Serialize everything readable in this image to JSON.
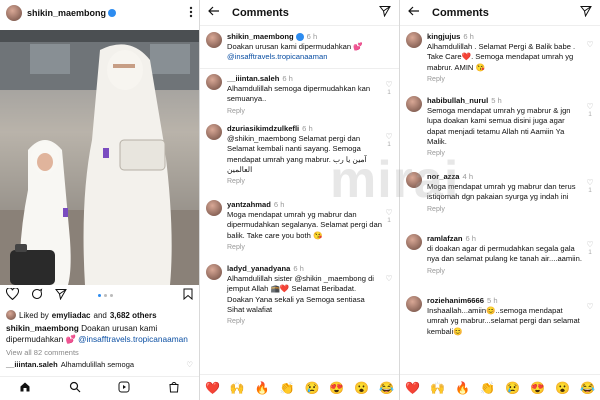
{
  "post": {
    "username": "shikin_maembong",
    "liked_by_prefix": "Liked by",
    "liked_by_user": "emyliadac",
    "liked_by_and": "and",
    "liked_by_count": "3,682 others",
    "caption_user": "shikin_maembong",
    "caption_text": "Doakan urusan kami dipermudahkan 💕",
    "caption_link": "@insafftravels.tropicanaaman",
    "view_all": "View all 82 comments",
    "first_comment_user": "__iiintan.saleh",
    "first_comment_text": "Alhamdulillah semoga"
  },
  "comments_panel_1": {
    "title": "Comments",
    "header_comment": {
      "user": "shikin_maembong",
      "time": "6 h",
      "text": "Doakan urusan kami dipermudahkan 💕",
      "link": "@insafftravels.tropicanaaman"
    },
    "comments": [
      {
        "user": "__iiintan.saleh",
        "time": "6 h",
        "text": "Alhamdulillah semoga dipermudahkan kan semuanya..",
        "reply": "Reply",
        "likes": "1"
      },
      {
        "user": "dzuriasikimdzulkefli",
        "time": "6 h",
        "text": "@shikin_maembong Selamat pergi dan Selamat kembali nanti sayang. Semoga mendapat umrah yang mabrur. آمين يا رب العالمين",
        "reply": "Reply",
        "likes": "1"
      },
      {
        "user": "yantzahmad",
        "time": "6 h",
        "text": "Moga mendapat umrah yg mabrur dan dipermudahkan segalanya. Selamat pergi dan balik. Take care you both 😘",
        "reply": "Reply",
        "likes": "1"
      },
      {
        "user": "ladyd_yanadyana",
        "time": "6 h",
        "text": "Alhamdulillah sister @shikin _maembong di jemput Allah 🕋❤️ Selamat Beribadat. Doakan Yana sekali ya Semoga sentiasa Sihat walafiat",
        "reply": "Reply",
        "likes": ""
      }
    ]
  },
  "comments_panel_2": {
    "title": "Comments",
    "comments": [
      {
        "user": "kingjujus",
        "time": "6 h",
        "text": "Alhamdulillah . Selamat Pergi & Balik babe . Take Care❤️. Semoga mendapat umrah yg mabrur. AMIN 😘",
        "reply": "Reply",
        "likes": ""
      },
      {
        "user": "habibullah_nurul",
        "time": "5 h",
        "text": "Semoga mendapat umrah yg mabrur & jgn lupa doakan kami semua disini juga agar dapat menjadi tetamu Allah nti Aamiin Ya Malik.",
        "reply": "Reply",
        "likes": "1"
      },
      {
        "user": "nor_azza",
        "time": "4 h",
        "text": "Moga mendapat umrah yg mabrur dan terus istiqomah dgn pakaian syurga yg indah ini",
        "reply": "Reply",
        "likes": "1"
      },
      {
        "user": "ramlafzan",
        "time": "6 h",
        "text": "di doakan agar di permudahkan segala gala nya dan selamat pulang ke tanah air....aamiin.",
        "reply": "Reply",
        "likes": "1"
      },
      {
        "user": "roziehanim6666",
        "time": "5 h",
        "text": "Inshaallah...amiin😊..semoga mendapat umrah yg mabrur...selamat pergi dan selamat kembali😊",
        "reply": "",
        "likes": ""
      }
    ]
  },
  "emojis": [
    "❤️",
    "🙌",
    "🔥",
    "👏",
    "😢",
    "😍",
    "😮",
    "😂"
  ],
  "watermark": "mirai",
  "icons": {
    "more": "more-vertical-icon",
    "back": "back-arrow-icon",
    "send": "send-icon",
    "like": "heart-icon",
    "comment": "comment-icon",
    "share": "share-icon",
    "bookmark": "bookmark-icon",
    "home": "home-icon",
    "search": "search-icon",
    "reels": "reels-icon",
    "shop": "shop-icon"
  },
  "colors": {
    "link": "#0b4fa3",
    "verified": "#2d8cf0"
  }
}
